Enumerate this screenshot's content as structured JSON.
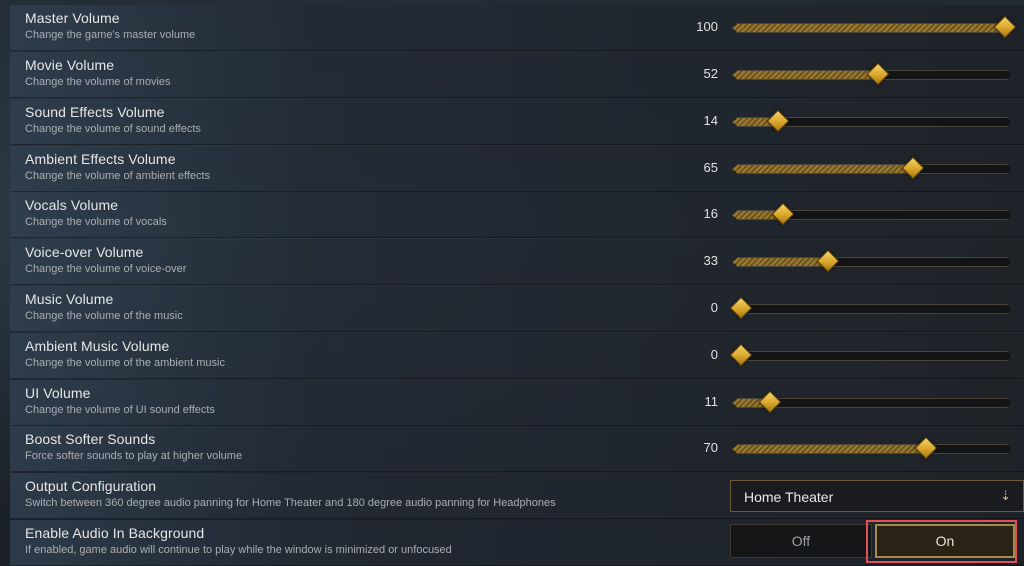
{
  "sliders": [
    {
      "label": "Master Volume",
      "description": "Change the game's master volume",
      "value": "100",
      "level": 1.0
    },
    {
      "label": "Movie Volume",
      "description": "Change the volume of movies",
      "value": "52",
      "level": 0.52
    },
    {
      "label": "Sound Effects Volume",
      "description": "Change the volume of sound effects",
      "value": "14",
      "level": 0.14
    },
    {
      "label": "Ambient Effects Volume",
      "description": "Change the volume of ambient effects",
      "value": "65",
      "level": 0.65
    },
    {
      "label": "Vocals Volume",
      "description": "Change the volume of vocals",
      "value": "16",
      "level": 0.16
    },
    {
      "label": "Voice-over Volume",
      "description": "Change the volume of voice-over",
      "value": "33",
      "level": 0.33
    },
    {
      "label": "Music Volume",
      "description": "Change the volume of the music",
      "value": "0",
      "level": 0.0
    },
    {
      "label": "Ambient Music Volume",
      "description": "Change the volume of the ambient music",
      "value": "0",
      "level": 0.0
    },
    {
      "label": "UI Volume",
      "description": "Change the volume of UI sound effects",
      "value": "11",
      "level": 0.11
    },
    {
      "label": "Boost Softer Sounds",
      "description": "Force softer sounds to play at higher volume",
      "value": "70",
      "level": 0.7
    }
  ],
  "output_config": {
    "label": "Output Configuration",
    "description": "Switch between 360 degree audio panning for Home Theater and 180 degree audio panning for Headphones",
    "selected": "Home Theater",
    "icon": "chevron-down-icon"
  },
  "background_audio": {
    "label": "Enable Audio In Background",
    "description": "If enabled, game audio will continue to play while the window is minimized or unfocused",
    "off_label": "Off",
    "on_label": "On",
    "selected": "On"
  },
  "colors": {
    "accent_gold": "#d9a62a",
    "highlight_red": "#e0505a"
  }
}
